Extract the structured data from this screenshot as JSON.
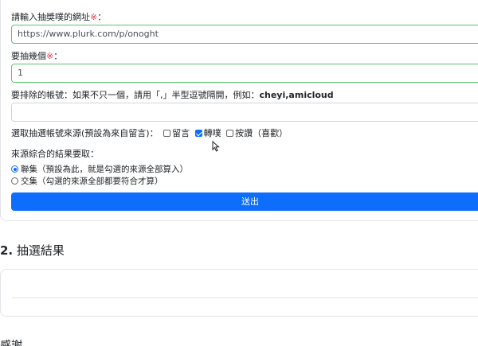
{
  "form": {
    "url_label": "請輸入抽獎噗的網址",
    "required_mark": "※",
    "label_colon": "：",
    "url_value": "https://www.plurk.com/p/onoght",
    "count_label": "要抽幾個",
    "count_value": "1",
    "exclude_label_prefix": "要排除的帳號：如果不只一個，請用「,」半型逗號隔開，例如：",
    "exclude_example": "cheyi,amicloud",
    "exclude_value": "",
    "source_label": "選取抽選帳號來源(預設為來自留言)：",
    "sources": [
      {
        "label": "留言",
        "checked": false
      },
      {
        "label": "轉噗",
        "checked": true
      },
      {
        "label": "按讚（喜歡）",
        "checked": false
      }
    ],
    "combine_label": "來源綜合的結果要取：",
    "combine_options": [
      {
        "label": "聯集（預設為此，就是勾選的來源全部算入）",
        "checked": true
      },
      {
        "label": "交集（勾選的來源全部都要符合才算）",
        "checked": false
      }
    ],
    "submit_label": "送出"
  },
  "results": {
    "number": "2.",
    "title": "抽選結果"
  },
  "footer": {
    "thanks_label": "感謝"
  },
  "icons": {
    "cursor": "mouse-pointer-icon"
  },
  "colors": {
    "primary": "#0d6efd",
    "required": "#dc3545",
    "valid_border": "#5cc46a"
  }
}
